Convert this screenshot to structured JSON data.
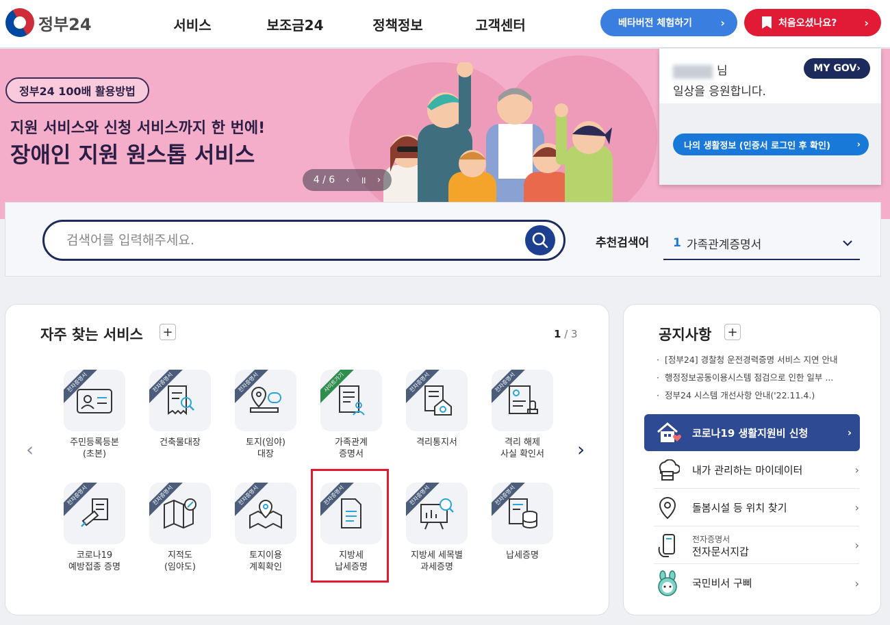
{
  "header": {
    "logo_text": "정부24",
    "nav": [
      "서비스",
      "보조금24",
      "정책정보",
      "고객센터"
    ],
    "beta_button": "베타버전 체험하기",
    "first_visit_button": "처음오셨나요?"
  },
  "banner": {
    "tag": "정부24 100배 활용방법",
    "subtitle": "지원 서비스와 신청 서비스까지 한 번에!",
    "title": "장애인 지원 원스톱 서비스",
    "pager": "4 / 6"
  },
  "user": {
    "suffix": "님",
    "greeting": "일상을 응원합니다.",
    "mygov": "MY GOV",
    "life_info": "나의 생활정보 (인증서 로그인 후 확인)"
  },
  "search": {
    "placeholder": "검색어를 입력해주세요.",
    "rec_label": "추천검색어",
    "rec_num": "1",
    "rec_text": "가족관계증명서"
  },
  "services": {
    "title": "자주 찾는 서비스",
    "page_current": "1",
    "page_total": " / 3",
    "ribbon_cert": "전자증명서",
    "ribbon_site": "사이트가기",
    "tiles": [
      {
        "line1": "주민등록등본",
        "line2": "(초본)"
      },
      {
        "line1": "건축물대장",
        "line2": ""
      },
      {
        "line1": "토지(임야)",
        "line2": "대장"
      },
      {
        "line1": "가족관계",
        "line2": "증명서"
      },
      {
        "line1": "격리통지서",
        "line2": ""
      },
      {
        "line1": "격리 해제",
        "line2": "사실 확인서"
      },
      {
        "line1": "코로나19",
        "line2": "예방접종 증명"
      },
      {
        "line1": "지적도",
        "line2": "(임야도)"
      },
      {
        "line1": "토지이용",
        "line2": "계획확인"
      },
      {
        "line1": "지방세",
        "line2": "납세증명"
      },
      {
        "line1": "지방세 세목별",
        "line2": "과세증명"
      },
      {
        "line1": "납세증명",
        "line2": ""
      }
    ]
  },
  "notice": {
    "title": "공지사항",
    "items": [
      "[정부24] 경찰청 운전경력증명 서비스 지연 안내",
      "행정정보공동이용시스템 점검으로 인한 일부 ...",
      "정부24 시스템 개선사항 안내('22.11.4.)"
    ],
    "covid": "코로나19 생활지원비 신청",
    "links": {
      "mydata": "내가 관리하는 마이데이터",
      "care": "돌봄시설 등 위치 찾기",
      "wallet_sub": "전자증명서",
      "wallet": "전자문서지갑",
      "gubbi": "국민비서 구삐"
    }
  },
  "colors": {
    "navy": "#1d2b5c",
    "blue": "#3a7ee0",
    "red": "#e11a36",
    "pink": "#f4aec9",
    "highlight": "#e01b2f"
  }
}
